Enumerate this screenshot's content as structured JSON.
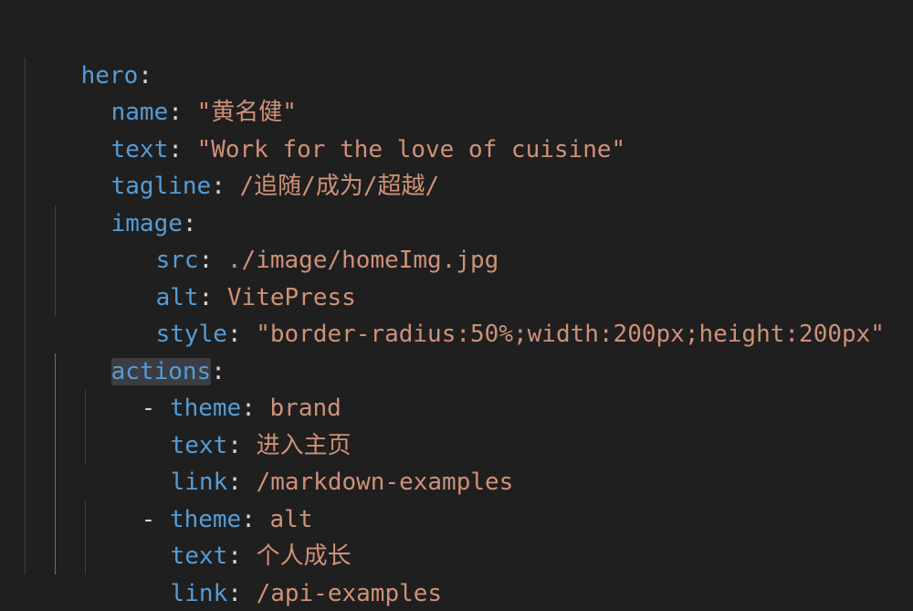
{
  "lines": [
    {
      "key": "hero",
      "sep": ":",
      "value": ""
    },
    {
      "key": "name",
      "sep": ": ",
      "value": "\"黄名健\""
    },
    {
      "key": "text",
      "sep": ": ",
      "value": "\"Work for the love of cuisine\""
    },
    {
      "key": "tagline",
      "sep": ": ",
      "value": "/追随/成为/超越/"
    },
    {
      "key": "image",
      "sep": ":",
      "value": ""
    },
    {
      "key": "src",
      "sep": ": ",
      "value": "./image/homeImg.jpg"
    },
    {
      "key": "alt",
      "sep": ": ",
      "value": "VitePress"
    },
    {
      "key": "style",
      "sep": ": ",
      "value": "\"border-radius:50%;width:200px;height:200px\""
    },
    {
      "key": "actions",
      "sep": ":",
      "value": ""
    },
    {
      "dash": "- ",
      "key": "theme",
      "sep": ": ",
      "value": "brand"
    },
    {
      "key": "text",
      "sep": ": ",
      "value": "进入主页"
    },
    {
      "key": "link",
      "sep": ": ",
      "value": "/markdown-examples"
    },
    {
      "dash": "- ",
      "key": "theme",
      "sep": ": ",
      "value": "alt"
    },
    {
      "key": "text",
      "sep": ": ",
      "value": "个人成长"
    },
    {
      "key": "link",
      "sep": ": ",
      "value": "/api-examples"
    }
  ]
}
